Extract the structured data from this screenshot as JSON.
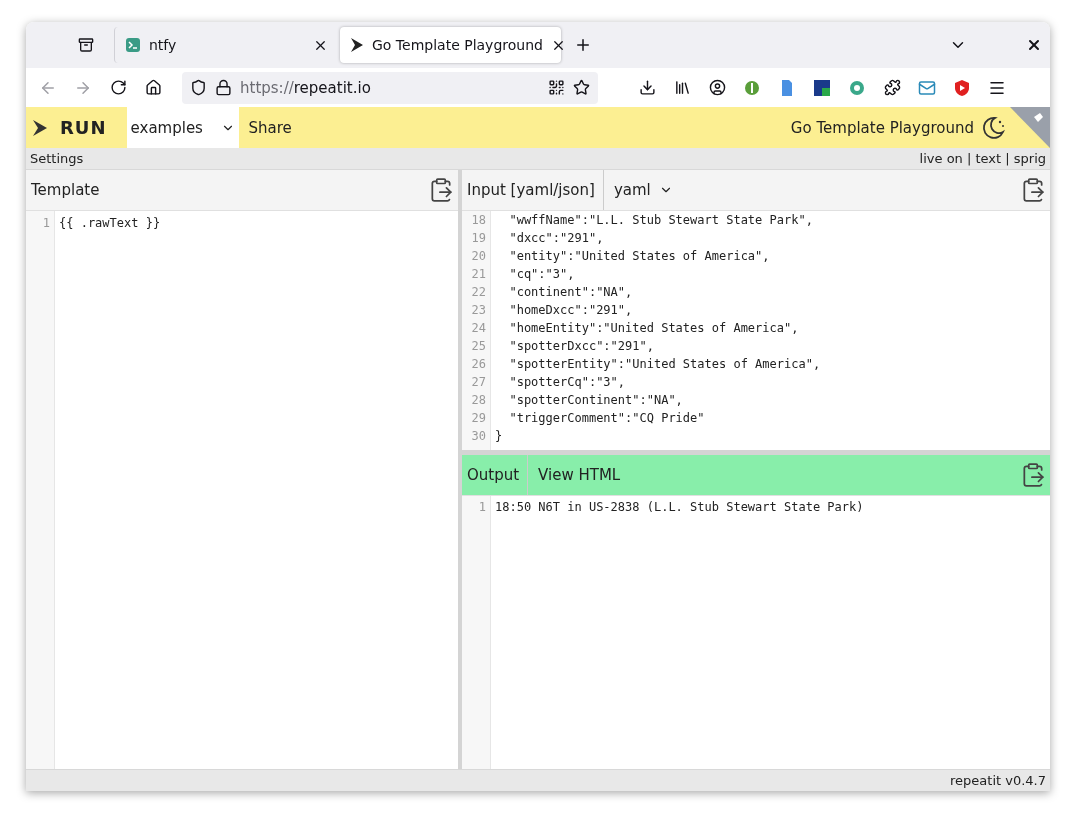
{
  "browser": {
    "tabs": [
      {
        "title": "ntfy",
        "kind": "terminal",
        "selected": false
      },
      {
        "title": "Go Template Playground",
        "kind": "app",
        "selected": true
      }
    ],
    "url_scheme": "https://",
    "url_host": "repeatit.io"
  },
  "header": {
    "run": "RUN",
    "examples": "examples",
    "share": "Share",
    "title": "Go Template Playground"
  },
  "settings_bar": {
    "label": "Settings",
    "options": "live on | text | sprig"
  },
  "template": {
    "title": "Template",
    "lines": [
      {
        "number": "1",
        "text": "{{ .rawText }}"
      }
    ]
  },
  "input": {
    "title": "Input [yaml/json]",
    "format": "yaml",
    "lines": [
      {
        "number": "18",
        "text": "  \"wwffName\":\"L.L. Stub Stewart State Park\","
      },
      {
        "number": "19",
        "text": "  \"dxcc\":\"291\","
      },
      {
        "number": "20",
        "text": "  \"entity\":\"United States of America\","
      },
      {
        "number": "21",
        "text": "  \"cq\":\"3\","
      },
      {
        "number": "22",
        "text": "  \"continent\":\"NA\","
      },
      {
        "number": "23",
        "text": "  \"homeDxcc\":\"291\","
      },
      {
        "number": "24",
        "text": "  \"homeEntity\":\"United States of America\","
      },
      {
        "number": "25",
        "text": "  \"spotterDxcc\":\"291\","
      },
      {
        "number": "26",
        "text": "  \"spotterEntity\":\"United States of America\","
      },
      {
        "number": "27",
        "text": "  \"spotterCq\":\"3\","
      },
      {
        "number": "28",
        "text": "  \"spotterContinent\":\"NA\","
      },
      {
        "number": "29",
        "text": "  \"triggerComment\":\"CQ Pride\""
      },
      {
        "number": "30",
        "text": "}"
      }
    ]
  },
  "output": {
    "title": "Output",
    "view_html": "View HTML",
    "lines": [
      {
        "number": "1",
        "text": "18:50 N6T in US-2838 (L.L. Stub Stewart State Park)"
      }
    ]
  },
  "footer": {
    "version": "repeatit v0.4.7"
  }
}
